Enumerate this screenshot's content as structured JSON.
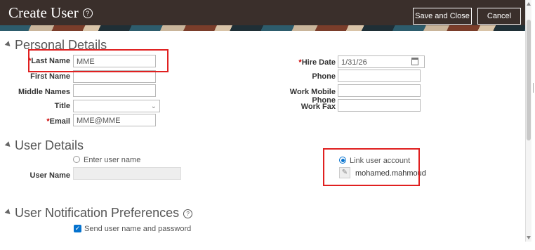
{
  "header": {
    "title": "Create User",
    "help_icon": "?",
    "save_close_label": "Save and Close",
    "cancel_label": "Cancel"
  },
  "personal": {
    "section_title": "Personal Details",
    "last_name_label": "Last Name",
    "last_name_value": "MME",
    "first_name_label": "First Name",
    "middle_names_label": "Middle Names",
    "title_label": "Title",
    "email_label": "Email",
    "email_value": "MME@MME",
    "hire_date_label": "Hire Date",
    "hire_date_value": "1/31/26",
    "phone_label": "Phone",
    "work_mobile_label": "Work Mobile Phone",
    "work_fax_label": "Work Fax",
    "required_mark": "*"
  },
  "user_details": {
    "section_title": "User Details",
    "enter_user_name_label": "Enter user name",
    "user_name_label": "User Name",
    "link_user_account_label": "Link user account",
    "linked_account_value": "mohamed.mahmoud"
  },
  "notifications": {
    "section_title": "User Notification Preferences",
    "send_credentials_label": "Send user name and password"
  },
  "colors": {
    "header_bg": "#3a2f2b",
    "highlight": "#e02020",
    "accent": "#0572ce"
  }
}
